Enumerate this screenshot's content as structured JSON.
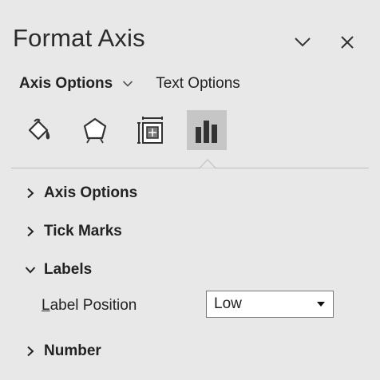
{
  "pane": {
    "title": "Format Axis",
    "collapse_icon": "chevron-down-icon",
    "close_icon": "close-icon"
  },
  "tabs": {
    "axis_options": "Axis Options",
    "text_options": "Text Options",
    "active": "axis_options"
  },
  "icon_tabs": [
    {
      "name": "fill-line-icon",
      "selected": false
    },
    {
      "name": "effects-icon",
      "selected": false
    },
    {
      "name": "size-properties-icon",
      "selected": false
    },
    {
      "name": "axis-options-icon",
      "selected": true
    }
  ],
  "sections": {
    "axis_options": {
      "label": "Axis Options",
      "expanded": false
    },
    "tick_marks": {
      "label": "Tick Marks",
      "expanded": false
    },
    "labels": {
      "label": "Labels",
      "expanded": true
    },
    "number": {
      "label": "Number",
      "expanded": false
    }
  },
  "labels": {
    "label_position_first": "L",
    "label_position_rest": "abel Position",
    "label_position_value": "Low"
  },
  "colors": {
    "background": "#e8e8e8",
    "selected_icon_bg": "#c6c6c6",
    "text": "#222222"
  }
}
